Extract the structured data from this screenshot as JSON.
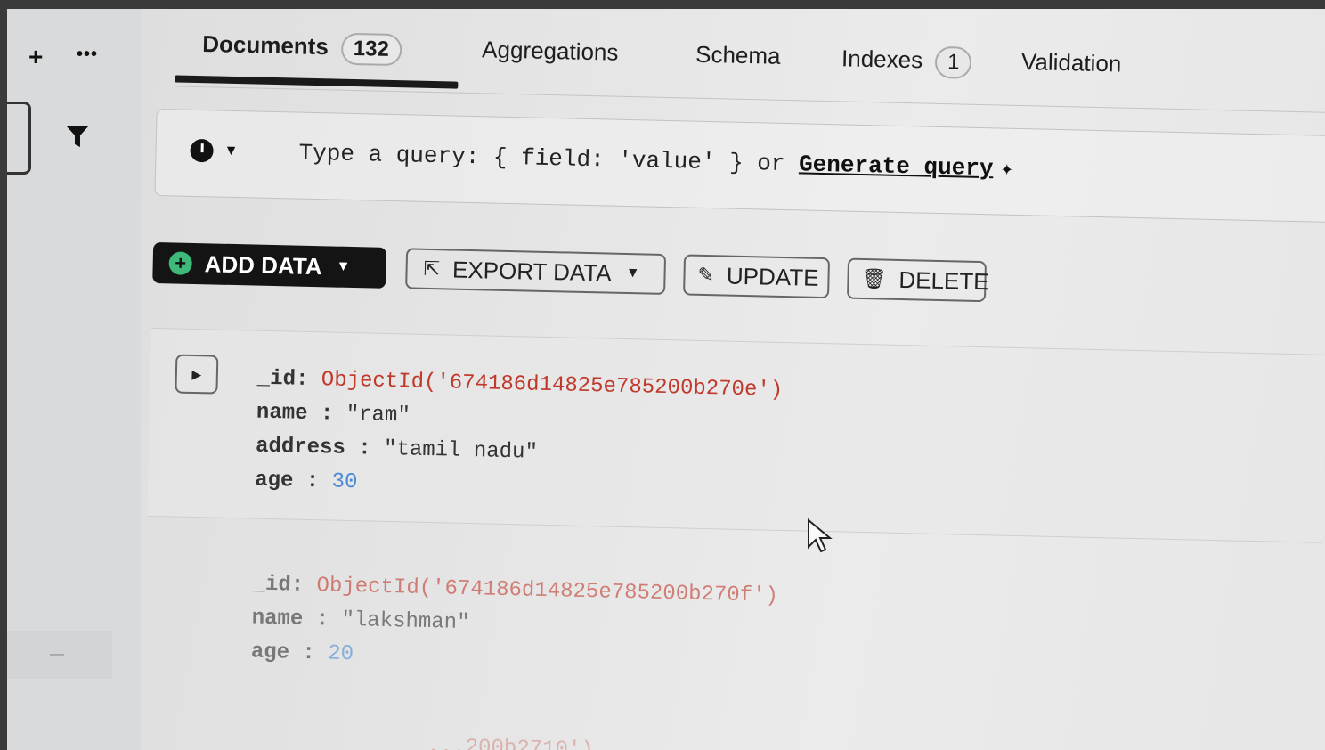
{
  "rail": {
    "plus": "+",
    "dots": "•••",
    "dash": "—"
  },
  "tabs": {
    "documents": {
      "label": "Documents",
      "count": "132"
    },
    "aggregations": {
      "label": "Aggregations"
    },
    "schema": {
      "label": "Schema"
    },
    "indexes": {
      "label": "Indexes",
      "count": "1"
    },
    "validation": {
      "label": "Validation"
    }
  },
  "query": {
    "placeholder": "Type a query: { field: 'value' } or ",
    "generate_label": "Generate query"
  },
  "toolbar": {
    "add_data": "ADD DATA",
    "export_data": "EXPORT DATA",
    "update": "UPDATE",
    "delete": "DELETE"
  },
  "documents": [
    {
      "id_key": "_id:",
      "id_value": "ObjectId('674186d14825e785200b270e')",
      "fields": [
        {
          "key": "name :",
          "value": "\"ram\""
        },
        {
          "key": "address :",
          "value": "\"tamil nadu\""
        },
        {
          "key": "age :",
          "value": "30"
        }
      ]
    },
    {
      "id_key": "_id:",
      "id_value": "ObjectId('674186d14825e785200b270f')",
      "fields": [
        {
          "key": "name :",
          "value": "\"lakshman\""
        },
        {
          "key": "age :",
          "value": "20"
        }
      ]
    },
    {
      "id_value": "...200b2710')"
    }
  ],
  "colors": {
    "accent": "#3fb97a",
    "object_id": "#c0392b",
    "number": "#4a8bd6",
    "dark": "#141414"
  }
}
